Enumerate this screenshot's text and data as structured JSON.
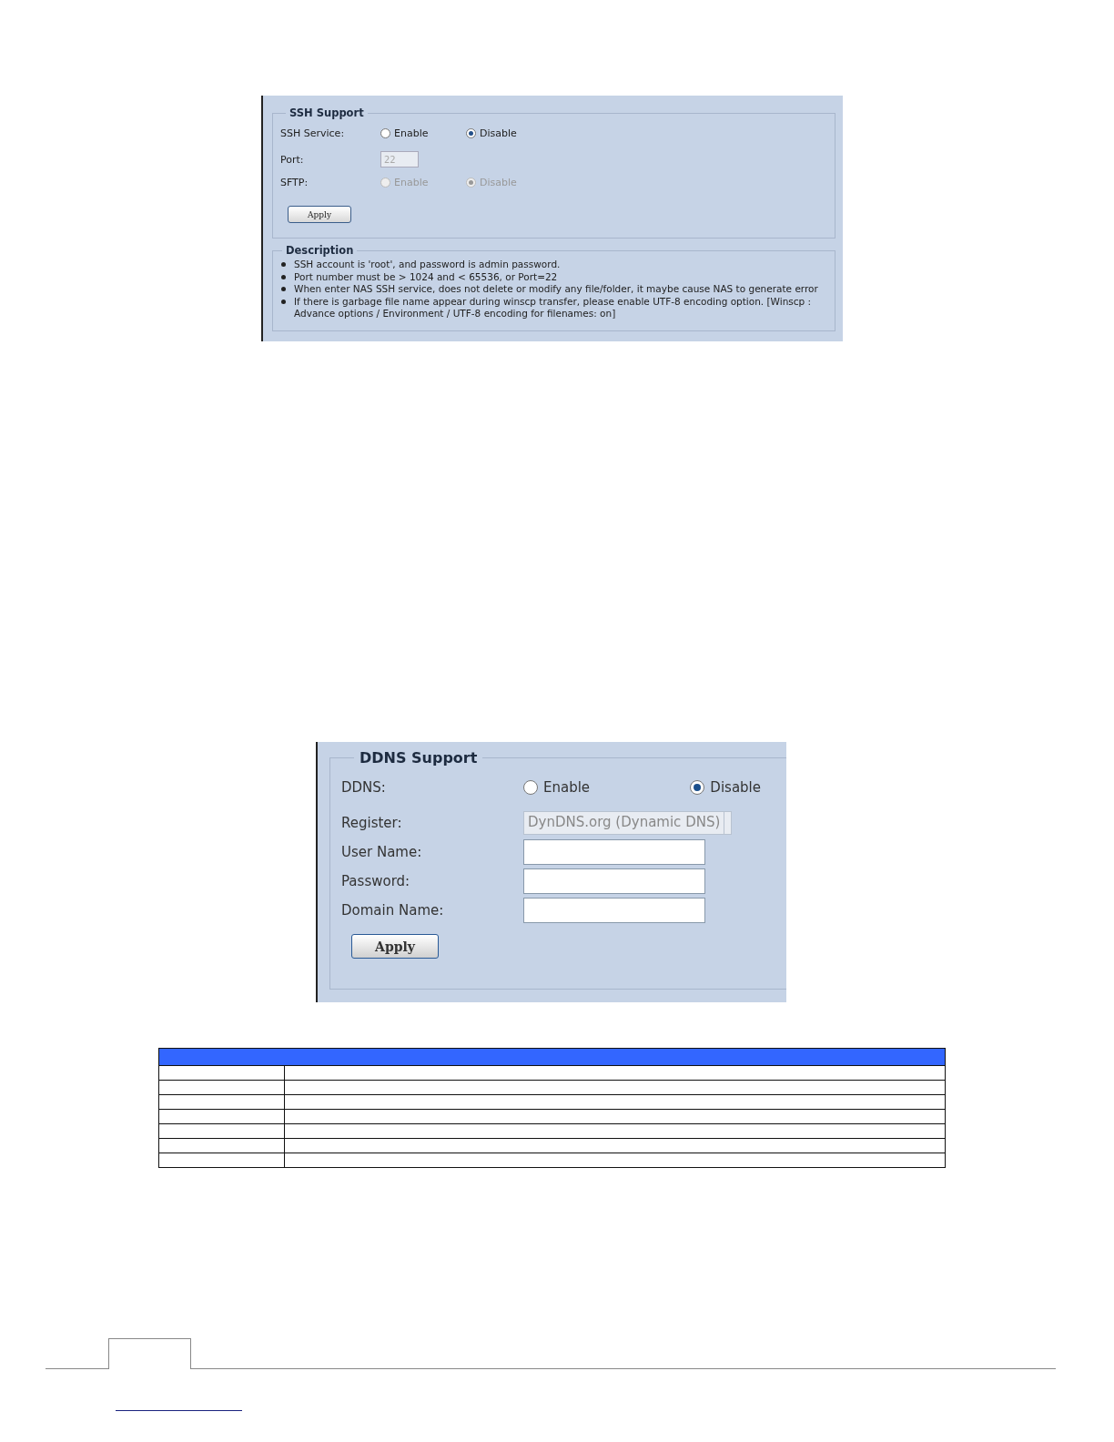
{
  "ssh": {
    "title": "SSH Support",
    "rows": [
      {
        "kind": "radio",
        "label": "SSH Service:",
        "disabled": false,
        "options": [
          {
            "label": "Enable",
            "selected": false
          },
          {
            "label": "Disable",
            "selected": true
          }
        ]
      },
      {
        "kind": "text",
        "label": "Port:",
        "value": "22",
        "disabled": true
      },
      {
        "kind": "radio",
        "label": "SFTP:",
        "disabled": true,
        "options": [
          {
            "label": "Enable",
            "selected": false
          },
          {
            "label": "Disable",
            "selected": true
          }
        ]
      }
    ],
    "apply": "Apply"
  },
  "description": {
    "title": "Description",
    "items": [
      "SSH account is 'root', and password is admin password.",
      "Port number must be > 1024 and < 65536, or Port=22",
      "When enter NAS SSH service, does not delete or modify any file/folder, it maybe cause NAS to generate error",
      "If there is garbage file name appear during winscp transfer, please enable UTF-8 encoding option. [Winscp : Advance options / Environment / UTF-8 encoding for filenames: on]"
    ]
  },
  "ddns": {
    "title": "DDNS Support",
    "rows": [
      {
        "kind": "radio",
        "label": "DDNS:",
        "options": [
          {
            "label": "Enable",
            "selected": false
          },
          {
            "label": "Disable",
            "selected": true
          }
        ]
      },
      {
        "kind": "select",
        "label": "Register:",
        "value": "DynDNS.org (Dynamic DNS)",
        "disabled": true
      },
      {
        "kind": "text",
        "label": "User Name:",
        "disabled": false
      },
      {
        "kind": "text",
        "label": "Password:",
        "disabled": false
      },
      {
        "kind": "text",
        "label": "Domain Name:",
        "disabled": false
      }
    ],
    "apply": "Apply"
  }
}
